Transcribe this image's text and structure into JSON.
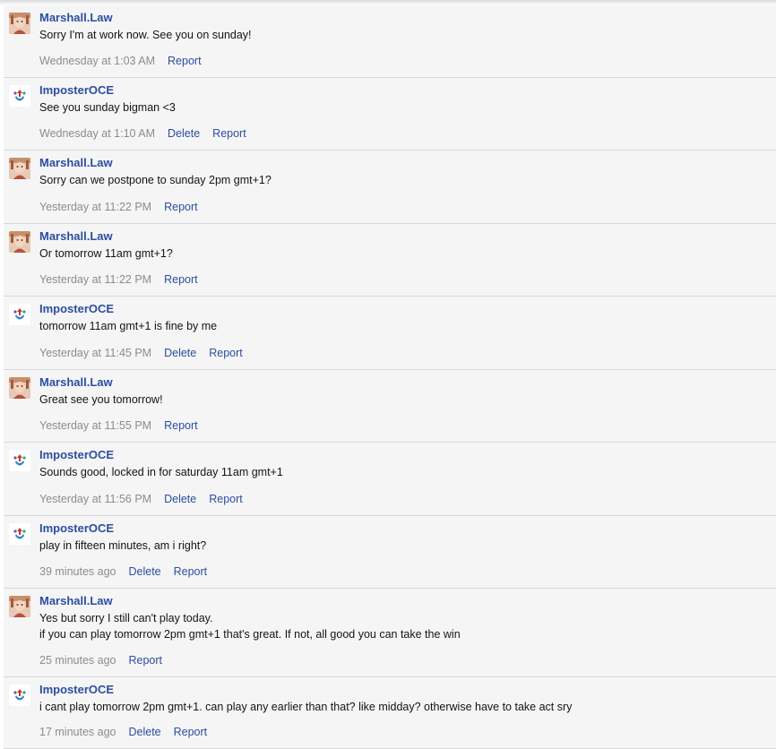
{
  "messages": [
    {
      "author": "Marshall.Law",
      "avatar": "marshall-avatar",
      "lines": [
        "Sorry I'm at work now. See you on sunday!"
      ],
      "time": "Wednesday at 1:03 AM",
      "actions": [
        "Report"
      ]
    },
    {
      "author": "ImposterOCE",
      "avatar": "imposter-avatar",
      "lines": [
        "See you sunday bigman <3"
      ],
      "time": "Wednesday at 1:10 AM",
      "actions": [
        "Delete",
        "Report"
      ]
    },
    {
      "author": "Marshall.Law",
      "avatar": "marshall-avatar",
      "lines": [
        "Sorry can we postpone to sunday 2pm gmt+1?"
      ],
      "time": "Yesterday at 11:22 PM",
      "actions": [
        "Report"
      ]
    },
    {
      "author": "Marshall.Law",
      "avatar": "marshall-avatar",
      "lines": [
        "Or tomorrow 11am gmt+1?"
      ],
      "time": "Yesterday at 11:22 PM",
      "actions": [
        "Report"
      ]
    },
    {
      "author": "ImposterOCE",
      "avatar": "imposter-avatar",
      "lines": [
        "tomorrow 11am gmt+1 is fine by me"
      ],
      "time": "Yesterday at 11:45 PM",
      "actions": [
        "Delete",
        "Report"
      ]
    },
    {
      "author": "Marshall.Law",
      "avatar": "marshall-avatar",
      "lines": [
        "Great see you tomorrow!"
      ],
      "time": "Yesterday at 11:55 PM",
      "actions": [
        "Report"
      ]
    },
    {
      "author": "ImposterOCE",
      "avatar": "imposter-avatar",
      "lines": [
        "Sounds good, locked in for saturday 11am gmt+1"
      ],
      "time": "Yesterday at 11:56 PM",
      "actions": [
        "Delete",
        "Report"
      ]
    },
    {
      "author": "ImposterOCE",
      "avatar": "imposter-avatar",
      "lines": [
        "play in fifteen minutes, am i right?"
      ],
      "time": "39 minutes ago",
      "actions": [
        "Delete",
        "Report"
      ]
    },
    {
      "author": "Marshall.Law",
      "avatar": "marshall-avatar",
      "lines": [
        "Yes but sorry I still can't play today.",
        "if you can play tomorrow 2pm gmt+1 that's great. If not, all good you can take the win"
      ],
      "time": "25 minutes ago",
      "actions": [
        "Report"
      ]
    },
    {
      "author": "ImposterOCE",
      "avatar": "imposter-avatar",
      "lines": [
        "i cant play tomorrow 2pm gmt+1. can play any earlier than that? like midday? otherwise have to take act sry"
      ],
      "time": "17 minutes ago",
      "actions": [
        "Delete",
        "Report"
      ]
    }
  ],
  "colors": {
    "link": "#2b4ea0",
    "muted": "#8c8c8c",
    "row_bg": "#f5f5f5",
    "divider": "#d5d8dc"
  }
}
